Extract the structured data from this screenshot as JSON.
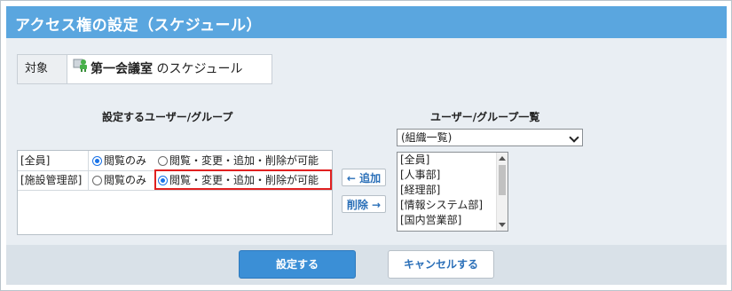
{
  "page": {
    "title": "アクセス権の設定（スケジュール）"
  },
  "target": {
    "label": "対象",
    "room_name": "第一会議室",
    "suffix": "のスケジュール",
    "icon": "meeting-room-icon"
  },
  "left_section": {
    "heading": "設定するユーザー/グループ"
  },
  "right_section": {
    "heading": "ユーザー/グループ一覧",
    "select_value": "(組織一覧)",
    "list_items": [
      "[全員]",
      "[人事部]",
      "[経理部]",
      "[情報システム部]",
      "[国内営業部]"
    ]
  },
  "permissions": [
    {
      "name": "[全員]",
      "opt1": "閲覧のみ",
      "opt2": "閲覧・変更・追加・削除が可能",
      "selected": 1
    },
    {
      "name": "[施設管理部]",
      "opt1": "閲覧のみ",
      "opt2": "閲覧・変更・追加・削除が可能",
      "selected": 2
    }
  ],
  "buttons": {
    "add": "← 追加",
    "remove": "削除 →",
    "save": "設定する",
    "cancel": "キャンセルする"
  },
  "colors": {
    "header": "#5aa6df",
    "primary_button": "#3b8fd6",
    "highlight": "#e02020",
    "panel": "#e9eef3"
  }
}
